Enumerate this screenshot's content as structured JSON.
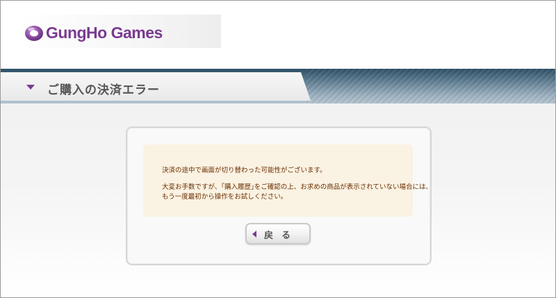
{
  "header": {
    "logo_text": "GungHo Games",
    "logo_icon": "gungho-logo-icon"
  },
  "title_bar": {
    "title": "ご購入の決済エラー",
    "arrow_icon": "triangle-down-icon"
  },
  "message": {
    "line1": "決済の途中で画面が切り替わった可能性がございます。",
    "line2": "大変お手数ですが、｢購入履歴｣をご確認の上、お求めの商品が表示されていない場合には、",
    "line3": "もう一度最初から操作をお試しください。"
  },
  "back_button": {
    "label": "戻る",
    "arrow_icon": "triangle-left-icon"
  },
  "colors": {
    "brand": "#7a3a90",
    "message_text": "#6b2e00",
    "message_bg": "#faf2e2",
    "band_dark": "#2d4f66"
  }
}
